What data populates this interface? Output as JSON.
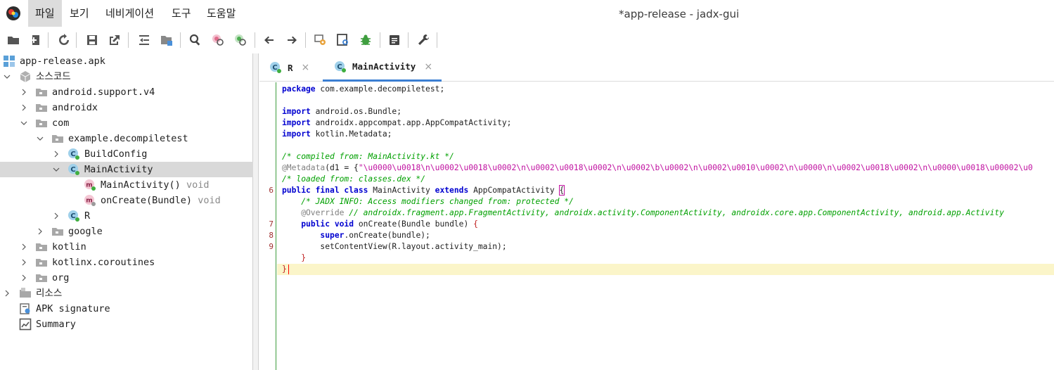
{
  "window": {
    "title": "*app-release - jadx-gui"
  },
  "menu": {
    "items": [
      "파일",
      "보기",
      "네비게이션",
      "도구",
      "도움말"
    ],
    "active_index": 0
  },
  "toolbar": {
    "buttons": [
      {
        "icon": "open-folder-icon"
      },
      {
        "icon": "add-files-icon"
      },
      {
        "icon": "reload-icon"
      },
      {
        "icon": "save-icon"
      },
      {
        "icon": "export-icon"
      },
      {
        "icon": "sync-tree-icon"
      },
      {
        "icon": "flatten-packages-icon"
      },
      {
        "icon": "search-icon"
      },
      {
        "icon": "find-usage-icon"
      },
      {
        "icon": "find-class-icon"
      },
      {
        "icon": "back-arrow-icon"
      },
      {
        "icon": "forward-arrow-icon"
      },
      {
        "icon": "deobfuscation-icon"
      },
      {
        "icon": "quick-search-icon"
      },
      {
        "icon": "debug-bug-icon"
      },
      {
        "icon": "log-viewer-icon"
      },
      {
        "icon": "preferences-wrench-icon"
      }
    ]
  },
  "tree": {
    "root": "app-release.apk",
    "source_code": "소스코드",
    "packages": [
      "android.support.v4",
      "androidx",
      "com"
    ],
    "com_child": "example.decompiletest",
    "classes": {
      "build_config": "BuildConfig",
      "main_activity": "MainActivity",
      "r": "R"
    },
    "methods": [
      {
        "name": "MainActivity()",
        "ret": "void"
      },
      {
        "name": "onCreate(Bundle)",
        "ret": "void"
      }
    ],
    "google": "google",
    "more_packages": [
      "kotlin",
      "kotlinx.coroutines",
      "org"
    ],
    "resources": "리소스",
    "apk_signature": "APK signature",
    "summary": "Summary"
  },
  "tabs": [
    {
      "label": "R",
      "active": false
    },
    {
      "label": "MainActivity",
      "active": true
    }
  ],
  "tab_close_glyph": "×",
  "editor": {
    "line_numbers": {
      "class_decl": "6",
      "method_decl": "7",
      "super_call": "8",
      "set_content": "9"
    },
    "code": {
      "l01_kw": "package",
      "l01_rest": " com.example.decompiletest;",
      "l03_kw": "import",
      "l03_rest": " android.os.Bundle;",
      "l04_kw": "import",
      "l04_rest": " androidx.appcompat.app.AppCompatActivity;",
      "l05_kw": "import",
      "l05_rest": " kotlin.Metadata;",
      "l07_comment": "/* compiled from: MainActivity.kt */",
      "l08_annotation": "@Metadata",
      "l08_mid": "(d1 = {",
      "l08_string": "\"\\u0000\\u0018\\n\\u0002\\u0018\\u0002\\n\\u0002\\u0018\\u0002\\n\\u0002\\b\\u0002\\n\\u0002\\u0010\\u0002\\n\\u0000\\n\\u0002\\u0018\\u0002\\n\\u0000\\u0018\\u00002\\u0",
      "l09_comment": "/* loaded from: classes.dex */",
      "l10_kw1": "public final class",
      "l10_name": " MainActivity ",
      "l10_kw2": "extends",
      "l10_super": " AppCompatActivity ",
      "l10_brace": "{",
      "l11_comment": "    /* JADX INFO: Access modifiers changed from: protected */",
      "l12_annotation": "    @Override",
      "l12_comment": " // androidx.fragment.app.FragmentActivity, androidx.activity.ComponentActivity, androidx.core.app.ComponentActivity, android.app.Activity",
      "l13_indent": "    ",
      "l13_kw": "public void",
      "l13_rest": " onCreate(Bundle bundle) ",
      "l13_brace": "{",
      "l14_indent": "        ",
      "l14_kw": "super",
      "l14_rest": ".onCreate(bundle);",
      "l15_text": "        setContentView(R.layout.activity_main);",
      "l16_brace": "    }",
      "l17_brace": "}"
    }
  },
  "colors": {
    "keyword": "#0000d0",
    "comment": "#00a000",
    "string": "#c010a0",
    "current_line": "#fbf5c9",
    "tab_active_underline": "#3b7fd2",
    "selected_row": "#d9d9d9"
  }
}
